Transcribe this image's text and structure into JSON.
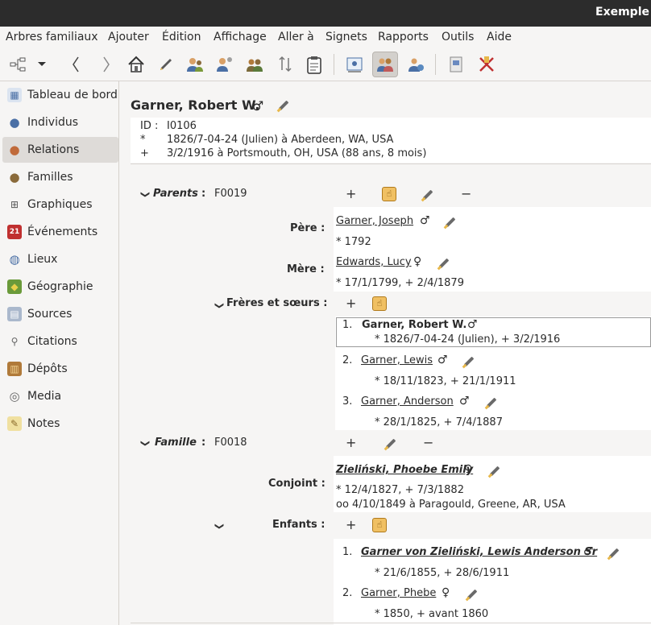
{
  "window": {
    "title": "Exemple -"
  },
  "menu": [
    "Arbres familiaux",
    "Ajouter",
    "Édition",
    "Affichage",
    "Aller à",
    "Signets",
    "Rapports",
    "Outils",
    "Aide"
  ],
  "toolbar": {
    "icons": [
      "tree-icon",
      "dropdown-arrow-icon",
      "back-icon",
      "forward-icon",
      "home-icon",
      "edit-icon",
      "person-add-icon",
      "person-merge-icon",
      "family-icon",
      "sort-icon",
      "clipboard-icon",
      "pedigree-view-icon",
      "relations-view-icon",
      "descendant-view-icon",
      "reports-icon",
      "tools-icon"
    ]
  },
  "sidebar": {
    "items": [
      {
        "label": "Tableau de bord",
        "icon": "dashboard-icon"
      },
      {
        "label": "Individus",
        "icon": "person-icon"
      },
      {
        "label": "Relations",
        "icon": "relations-icon"
      },
      {
        "label": "Familles",
        "icon": "families-icon"
      },
      {
        "label": "Graphiques",
        "icon": "charts-icon"
      },
      {
        "label": "Événements",
        "icon": "calendar-icon"
      },
      {
        "label": "Lieux",
        "icon": "globe-icon"
      },
      {
        "label": "Géographie",
        "icon": "map-icon"
      },
      {
        "label": "Sources",
        "icon": "book-icon"
      },
      {
        "label": "Citations",
        "icon": "citation-icon"
      },
      {
        "label": "Dépôts",
        "icon": "archive-icon"
      },
      {
        "label": "Media",
        "icon": "media-icon"
      },
      {
        "label": "Notes",
        "icon": "note-icon"
      }
    ],
    "selected": "Relations"
  },
  "person": {
    "name": "Garner, Robert W.",
    "gender": "♂",
    "id_label": "ID :",
    "id_value": "I0106",
    "birth_sym": "*",
    "birth": "1826/7-04-24 (Julien) à Aberdeen, WA, USA",
    "death_sym": "+",
    "death": "3/2/1916 à Portsmouth, OH, USA (88 ans, 8 mois)"
  },
  "parents": {
    "label": "Parents",
    "sep": ":",
    "family_id": "F0019",
    "father_label": "Père :",
    "father_name": "Garner, Joseph",
    "father_gender": "♂",
    "father_dates": "* 1792",
    "mother_label": "Mère :",
    "mother_name": "Edwards, Lucy",
    "mother_gender": "♀",
    "mother_dates": "* 17/1/1799, + 2/4/1879"
  },
  "siblings": {
    "label": "Frères et sœurs :",
    "items": [
      {
        "num": "1.",
        "name": "Garner, Robert W.",
        "gender": "♂",
        "dates": "* 1826/7-04-24 (Julien), + 3/2/1916"
      },
      {
        "num": "2.",
        "name": "Garner, Lewis",
        "gender": "♂",
        "dates": "* 18/11/1823, + 21/1/1911"
      },
      {
        "num": "3.",
        "name": "Garner, Anderson",
        "gender": "♂",
        "dates": "* 28/1/1825, + 7/4/1887"
      }
    ]
  },
  "family": {
    "label": "Famille",
    "sep": ":",
    "family_id": "F0018",
    "spouse_label": "Conjoint :",
    "spouse_name": "Zieliński, Phoebe Emily",
    "spouse_gender": "♀",
    "spouse_dates": "* 12/4/1827, + 7/3/1882",
    "marriage": "oo 4/10/1849 à Paragould, Greene, AR, USA",
    "children_label": "Enfants :",
    "children": [
      {
        "num": "1.",
        "name": "Garner von Zieliński, Lewis Anderson Sr",
        "gender": "♂",
        "dates": "* 21/6/1855, + 28/6/1911"
      },
      {
        "num": "2.",
        "name": "Garner, Phebe",
        "gender": "♀",
        "dates": "* 1850, + avant 1860"
      }
    ]
  },
  "buttons": {
    "add": "+",
    "remove": "−",
    "collapse": "❯"
  },
  "colors": {
    "titlebar": "#2c2c2c",
    "selected": "#dedbd8",
    "panel": "#ffffff"
  }
}
